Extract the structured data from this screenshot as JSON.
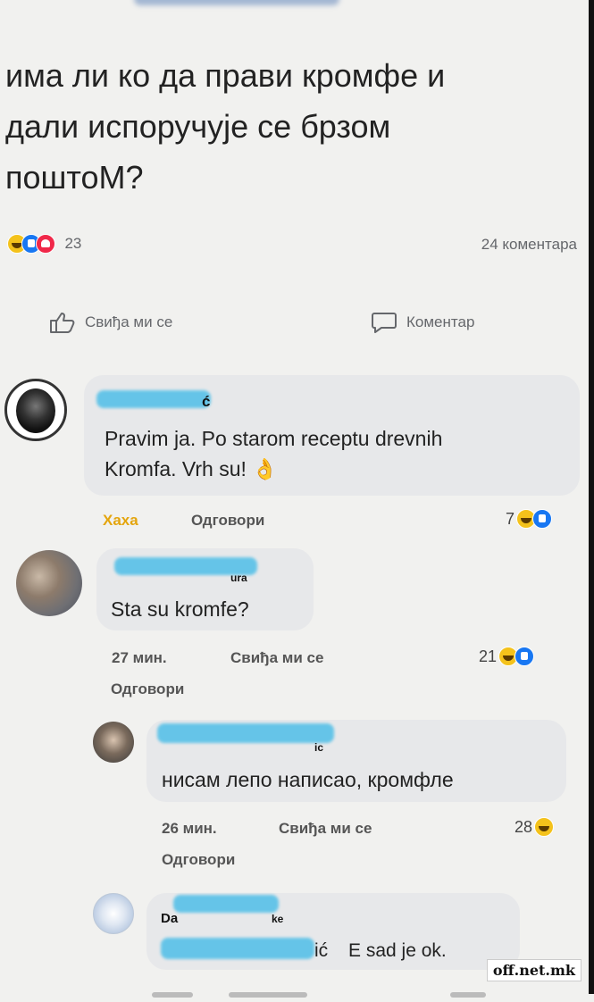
{
  "post": {
    "text_line1": "има ли ко да прави кромфе и",
    "text_line2": "дали испоручује се брзом",
    "text_line3": "поштоМ?"
  },
  "stats": {
    "reactions_count": "23",
    "comments_count": "24 коментара"
  },
  "actions": {
    "like_label": "Свиђа ми се",
    "comment_label": "Коментар"
  },
  "comments": [
    {
      "author_suffix": "ć",
      "text_line1": "Pravim ja. Po starom receptu drevnih",
      "text_line2": "Kromfa. Vrh su! 👌",
      "haha_label": "Хаха",
      "reply_label": "Одговори",
      "reactions": "7"
    },
    {
      "author_suffix": "ura",
      "text": "Sta su kromfe?",
      "time": "27 мин.",
      "like_label": "Свиђа ми се",
      "reply_label": "Одговори",
      "reactions": "21"
    },
    {
      "author_suffix": "ic",
      "text": "нисам лепо написао, кромфле",
      "time": "26 мин.",
      "like_label": "Свиђа ми се",
      "reply_label": "Одговори",
      "reactions": "28"
    },
    {
      "author_prefix": "Da",
      "author_suffix": "ke",
      "mention_suffix": "ić",
      "text": "E sad je ok."
    }
  ],
  "watermark": "off.net.mk"
}
